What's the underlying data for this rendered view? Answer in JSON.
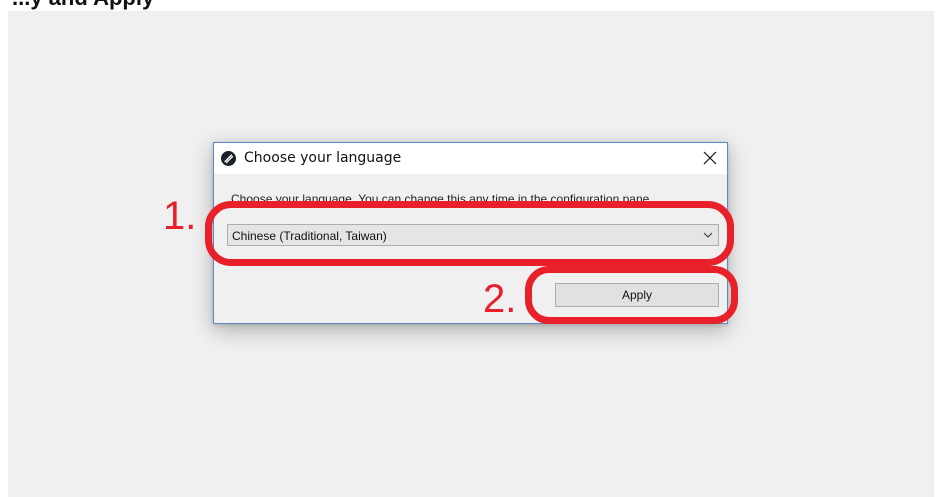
{
  "page_header_fragment": "...y and Apply",
  "dialog": {
    "title": "Choose your language",
    "prompt": "Choose your language. You can change this any time in the configuration pane",
    "language_select": {
      "selected_value": "Chinese (Traditional, Taiwan)"
    },
    "apply_label": "Apply"
  },
  "annotations": {
    "step_1_label": "1.",
    "step_2_label": "2."
  },
  "icons": {
    "app": "app-icon",
    "close": "close-icon",
    "dropdown": "chevron-down-icon"
  },
  "colors": {
    "highlight": "#e8202a",
    "dialog_border": "#5b8bc7",
    "dialog_background": "#f0f0f0"
  }
}
